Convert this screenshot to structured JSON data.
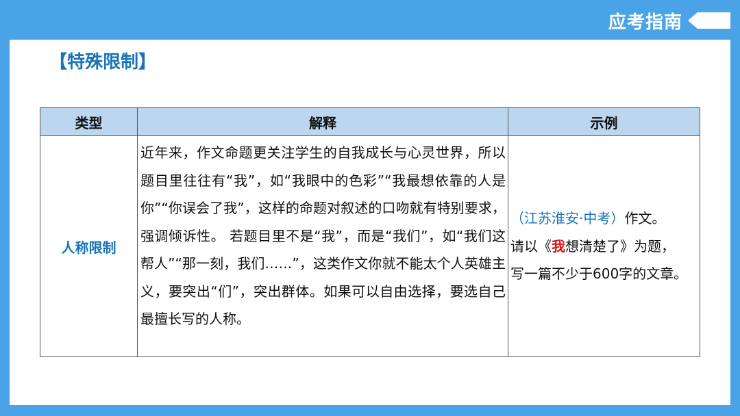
{
  "header": {
    "brand_label": "应考指南",
    "colors": {
      "background": "#4aa3e6",
      "accent": "#1a73b8",
      "header_row": "#bcd6ef",
      "highlight": "#e0141b"
    }
  },
  "section": {
    "title": "【特殊限制】"
  },
  "table": {
    "headers": [
      "类型",
      "解释",
      "示例"
    ],
    "rows": [
      {
        "type": "人称限制",
        "explanation": "近年来，作文命题更关注学生的自我成长与心灵世界，所以题目里往往有“我”，如“我眼中的色彩”“我最想依靠的人是你”“你误会了我”，这样的命题对叙述的口吻就有特别要求，强调倾诉性。 若题目里不是“我”，而是“我们”，如“我们这帮人”“那一刻，我们……”，这类作文你就不能太个人英雄主义，要突出“们”，突出群体。如果可以自由选择，要选自己最擅长写的人称。",
        "example": {
          "source": "（江苏淮安·中考）",
          "line1_rest": "作文。",
          "line2_prefix": "请以《",
          "line2_highlight": "我",
          "line2_suffix": "想清楚了》为题，",
          "line3": "写一篇不少于600字的文章。"
        }
      }
    ]
  }
}
